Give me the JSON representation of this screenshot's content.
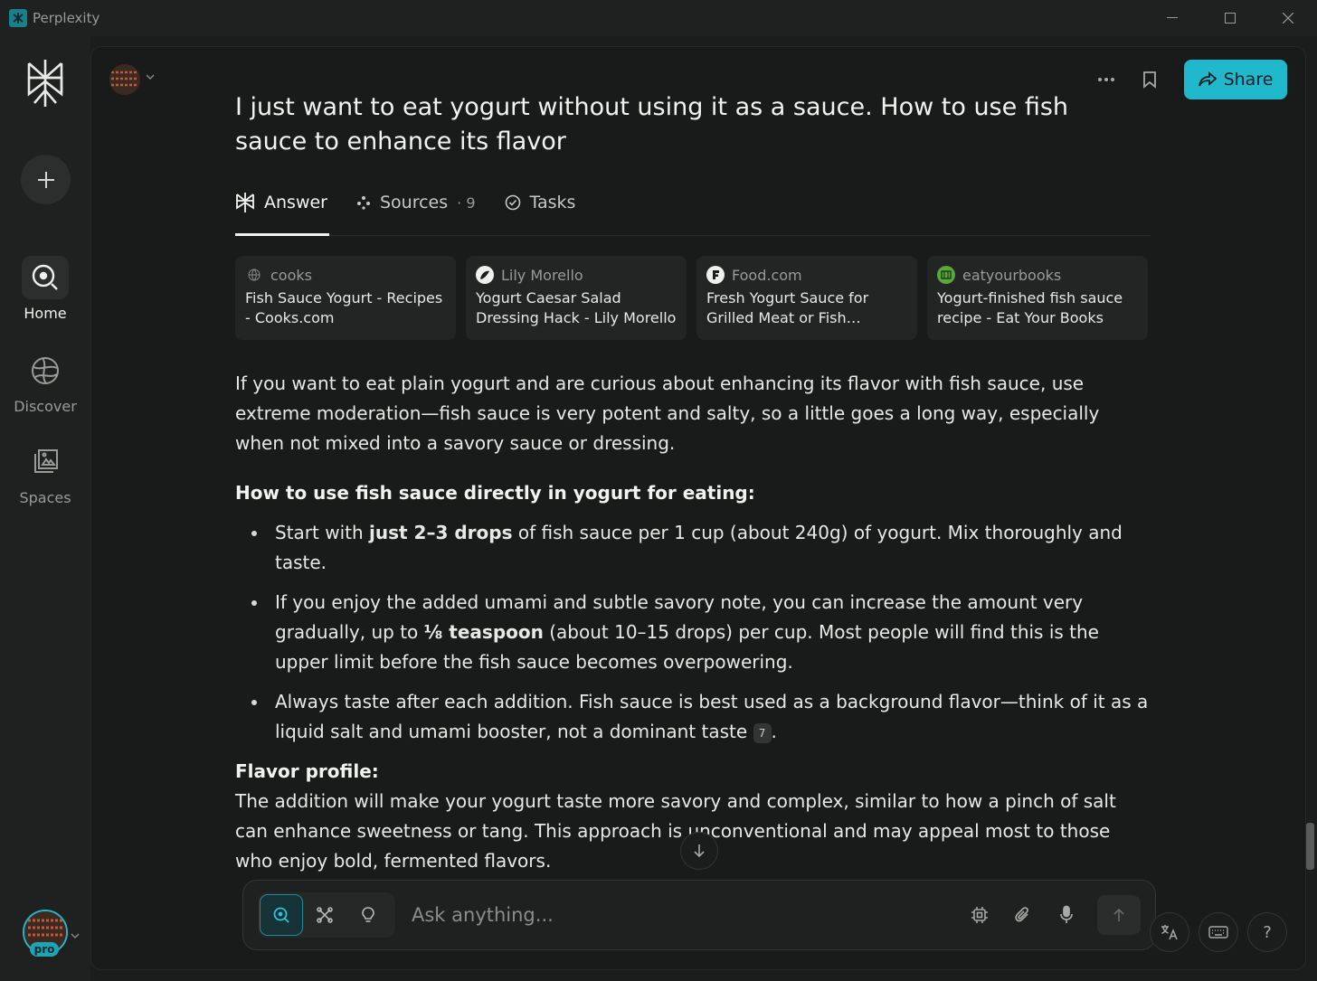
{
  "window": {
    "title": "Perplexity"
  },
  "sidebar": {
    "nav": [
      {
        "label": "Home",
        "icon": "home-search-icon"
      },
      {
        "label": "Discover",
        "icon": "globe-icon"
      },
      {
        "label": "Spaces",
        "icon": "spaces-icon"
      }
    ],
    "badge": "pro"
  },
  "header": {
    "share_label": "Share"
  },
  "thread": {
    "question": "I just want to eat yogurt without using it as a sauce. How to use fish sauce to enhance its flavor",
    "tabs": [
      {
        "label": "Answer"
      },
      {
        "label": "Sources",
        "count": "· 9"
      },
      {
        "label": "Tasks"
      }
    ],
    "sources": [
      {
        "site": "cooks",
        "title": "Fish Sauce Yogurt - Recipes - Cooks.com"
      },
      {
        "site": "Lily Morello",
        "title": "Yogurt Caesar Salad Dressing Hack - Lily Morello"
      },
      {
        "site": "Food.com",
        "title": "Fresh Yogurt Sauce for Grilled Meat or Fish Recipe..."
      },
      {
        "site": "eatyourbooks",
        "title": "Yogurt-finished fish sauce recipe - Eat Your Books"
      }
    ],
    "answer": {
      "intro": "If you want to eat plain yogurt and are curious about enhancing its flavor with fish sauce, use extreme moderation—fish sauce is very potent and salty, so a little goes a long way, especially when not mixed into a savory sauce or dressing.",
      "how_heading": "How to use fish sauce directly in yogurt for eating:",
      "bullet1_pre": "Start with ",
      "bullet1_bold": "just 2–3 drops",
      "bullet1_post": " of fish sauce per 1 cup (about 240g) of yogurt. Mix thoroughly and taste.",
      "bullet2_pre": "If you enjoy the added umami and subtle savory note, you can increase the amount very gradually, up to ",
      "bullet2_bold": "⅛ teaspoon",
      "bullet2_post": " (about 10–15 drops) per cup. Most people will find this is the upper limit before the fish sauce becomes overpowering.",
      "bullet3": "Always taste after each addition. Fish sauce is best used as a background flavor—think of it as a liquid salt and umami booster, not a dominant taste",
      "bullet3_cite": "7",
      "bullet3_end": ".",
      "flavor_heading": "Flavor profile:",
      "flavor_text": "The addition will make your yogurt taste more savory and complex, similar to how a pinch of salt can enhance sweetness or tang. This approach is unconventional and may appeal most to those who enjoy bold, fermented flavors."
    }
  },
  "ask": {
    "placeholder": "Ask anything..."
  },
  "colors": {
    "accent": "#21b8cd",
    "background": "#191a1a",
    "sidebar": "#1f2020"
  }
}
